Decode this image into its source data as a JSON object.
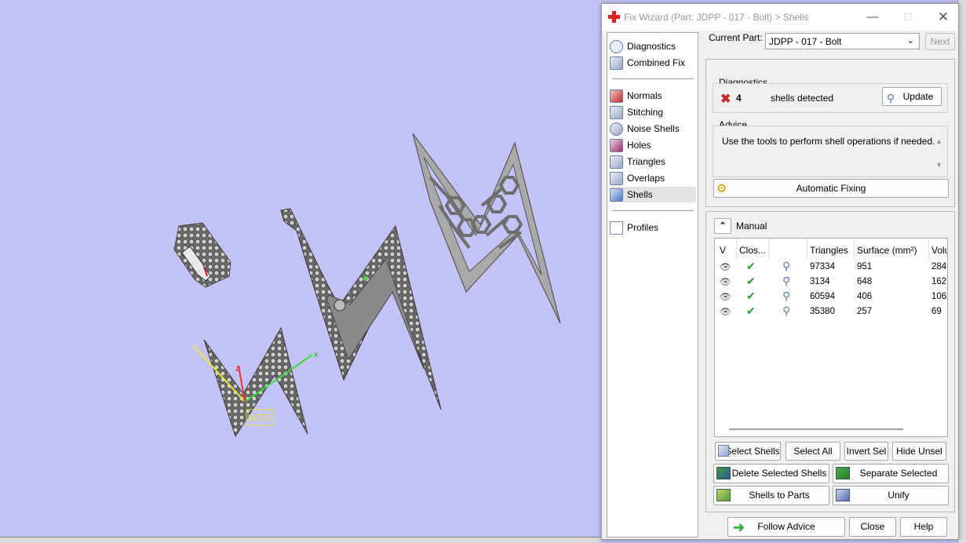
{
  "viewport": {
    "wcs_label": "WCS",
    "axis_x": "x",
    "axis_z": "z"
  },
  "wizard": {
    "title": "Fix Wizard (Part: JDPP - 017 - Bolt) > Shells",
    "nav": {
      "top": [
        "Diagnostics",
        "Combined Fix"
      ],
      "tools": [
        "Normals",
        "Stitching",
        "Noise Shells",
        "Holes",
        "Triangles",
        "Overlaps",
        "Shells"
      ],
      "bottom": [
        "Profiles"
      ],
      "active": "Shells"
    },
    "current_part_label": "Current Part:",
    "current_part_value": "JDPP - 017 - Bolt",
    "next_label": "Next",
    "diagnostics": {
      "title": "Diagnostics",
      "count": "4",
      "text": "shells detected",
      "update_label": "Update"
    },
    "advice": {
      "title": "Advice",
      "text": "Use the tools to perform shell operations if needed."
    },
    "automatic_fixing_label": "Automatic Fixing",
    "manual_label": "Manual",
    "table": {
      "headers": [
        "V",
        "Clos...",
        "",
        "Triangles",
        "Surface (mm²)",
        "Volu"
      ],
      "rows": [
        {
          "triangles": "97334",
          "surface": "951",
          "volume": "284"
        },
        {
          "triangles": "3134",
          "surface": "648",
          "volume": "162"
        },
        {
          "triangles": "60594",
          "surface": "406",
          "volume": "106"
        },
        {
          "triangles": "35380",
          "surface": "257",
          "volume": "69"
        }
      ]
    },
    "buttons": {
      "select_shells": "Select Shells",
      "select_all": "Select All",
      "invert_sel": "Invert Sel",
      "hide_unsel": "Hide Unsel",
      "delete_selected": "Delete Selected Shells",
      "separate_selected": "Separate Selected Shells",
      "shells_to_parts": "Shells to Parts",
      "unify": "Unify",
      "follow_advice": "Follow Advice",
      "close": "Close",
      "help": "Help"
    }
  }
}
